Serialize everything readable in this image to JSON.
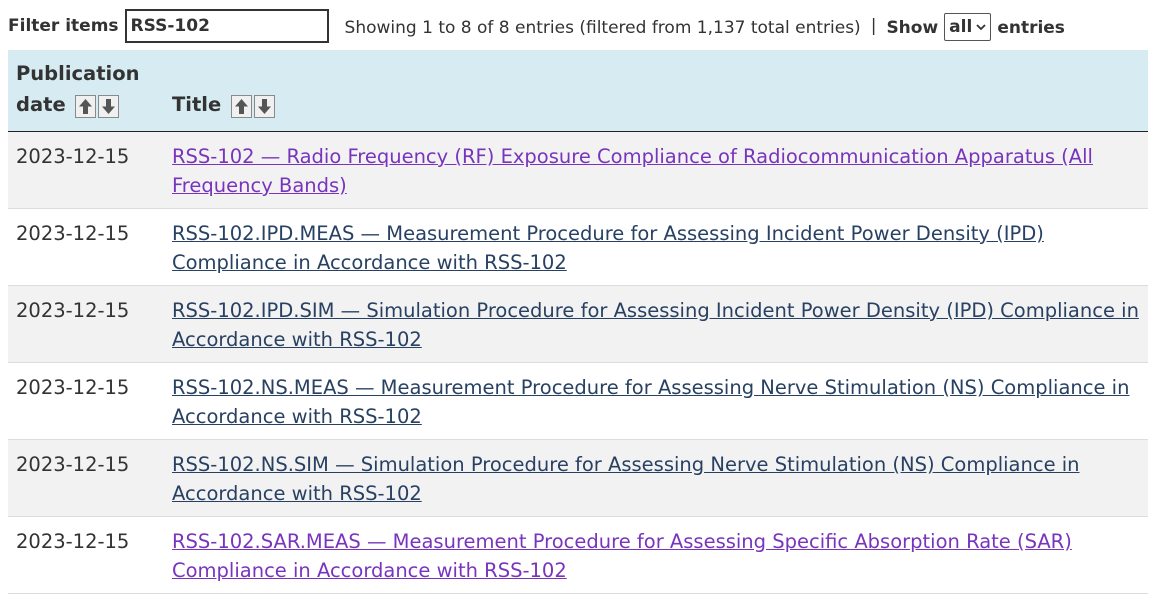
{
  "filter": {
    "label": "Filter items",
    "value": "RSS-102"
  },
  "info": {
    "showing": "Showing 1 to 8 of 8 entries (filtered from 1,137 total entries)",
    "separator": "|",
    "show_label": "Show",
    "length_value": "all",
    "entries_label": "entries"
  },
  "table": {
    "headers": {
      "date_line1": "Publication",
      "date_line2": "date",
      "title": "Title"
    },
    "rows": [
      {
        "date": "2023-12-15",
        "title": "RSS-102 — Radio Frequency (RF) Exposure Compliance of Radiocommunication Apparatus (All Frequency Bands)",
        "visited": true
      },
      {
        "date": "2023-12-15",
        "title": "RSS-102.IPD.MEAS — Measurement Procedure for Assessing Incident Power Density (IPD) Compliance in Accordance with RSS-102",
        "visited": false
      },
      {
        "date": "2023-12-15",
        "title": "RSS-102.IPD.SIM — Simulation Procedure for Assessing Incident Power Density (IPD) Compliance in Accordance with RSS-102",
        "visited": false
      },
      {
        "date": "2023-12-15",
        "title": "RSS-102.NS.MEAS — Measurement Procedure for Assessing Nerve Stimulation (NS) Compliance in Accordance with RSS-102",
        "visited": false
      },
      {
        "date": "2023-12-15",
        "title": "RSS-102.NS.SIM — Simulation Procedure for Assessing Nerve Stimulation (NS) Compliance in Accordance with RSS-102",
        "visited": false
      },
      {
        "date": "2023-12-15",
        "title": "RSS-102.SAR.MEAS — Measurement Procedure for Assessing Specific Absorption Rate (SAR) Compliance in Accordance with RSS-102",
        "visited": true
      }
    ]
  },
  "icons": {
    "sort_up": "arrow-up-icon",
    "sort_down": "arrow-down-icon",
    "select_chevron": "chevron-down-icon"
  },
  "colors": {
    "header_bg": "#d7ebf3",
    "link": "#284162",
    "visited_link": "#7834bc",
    "stripe": "#f2f2f2"
  }
}
